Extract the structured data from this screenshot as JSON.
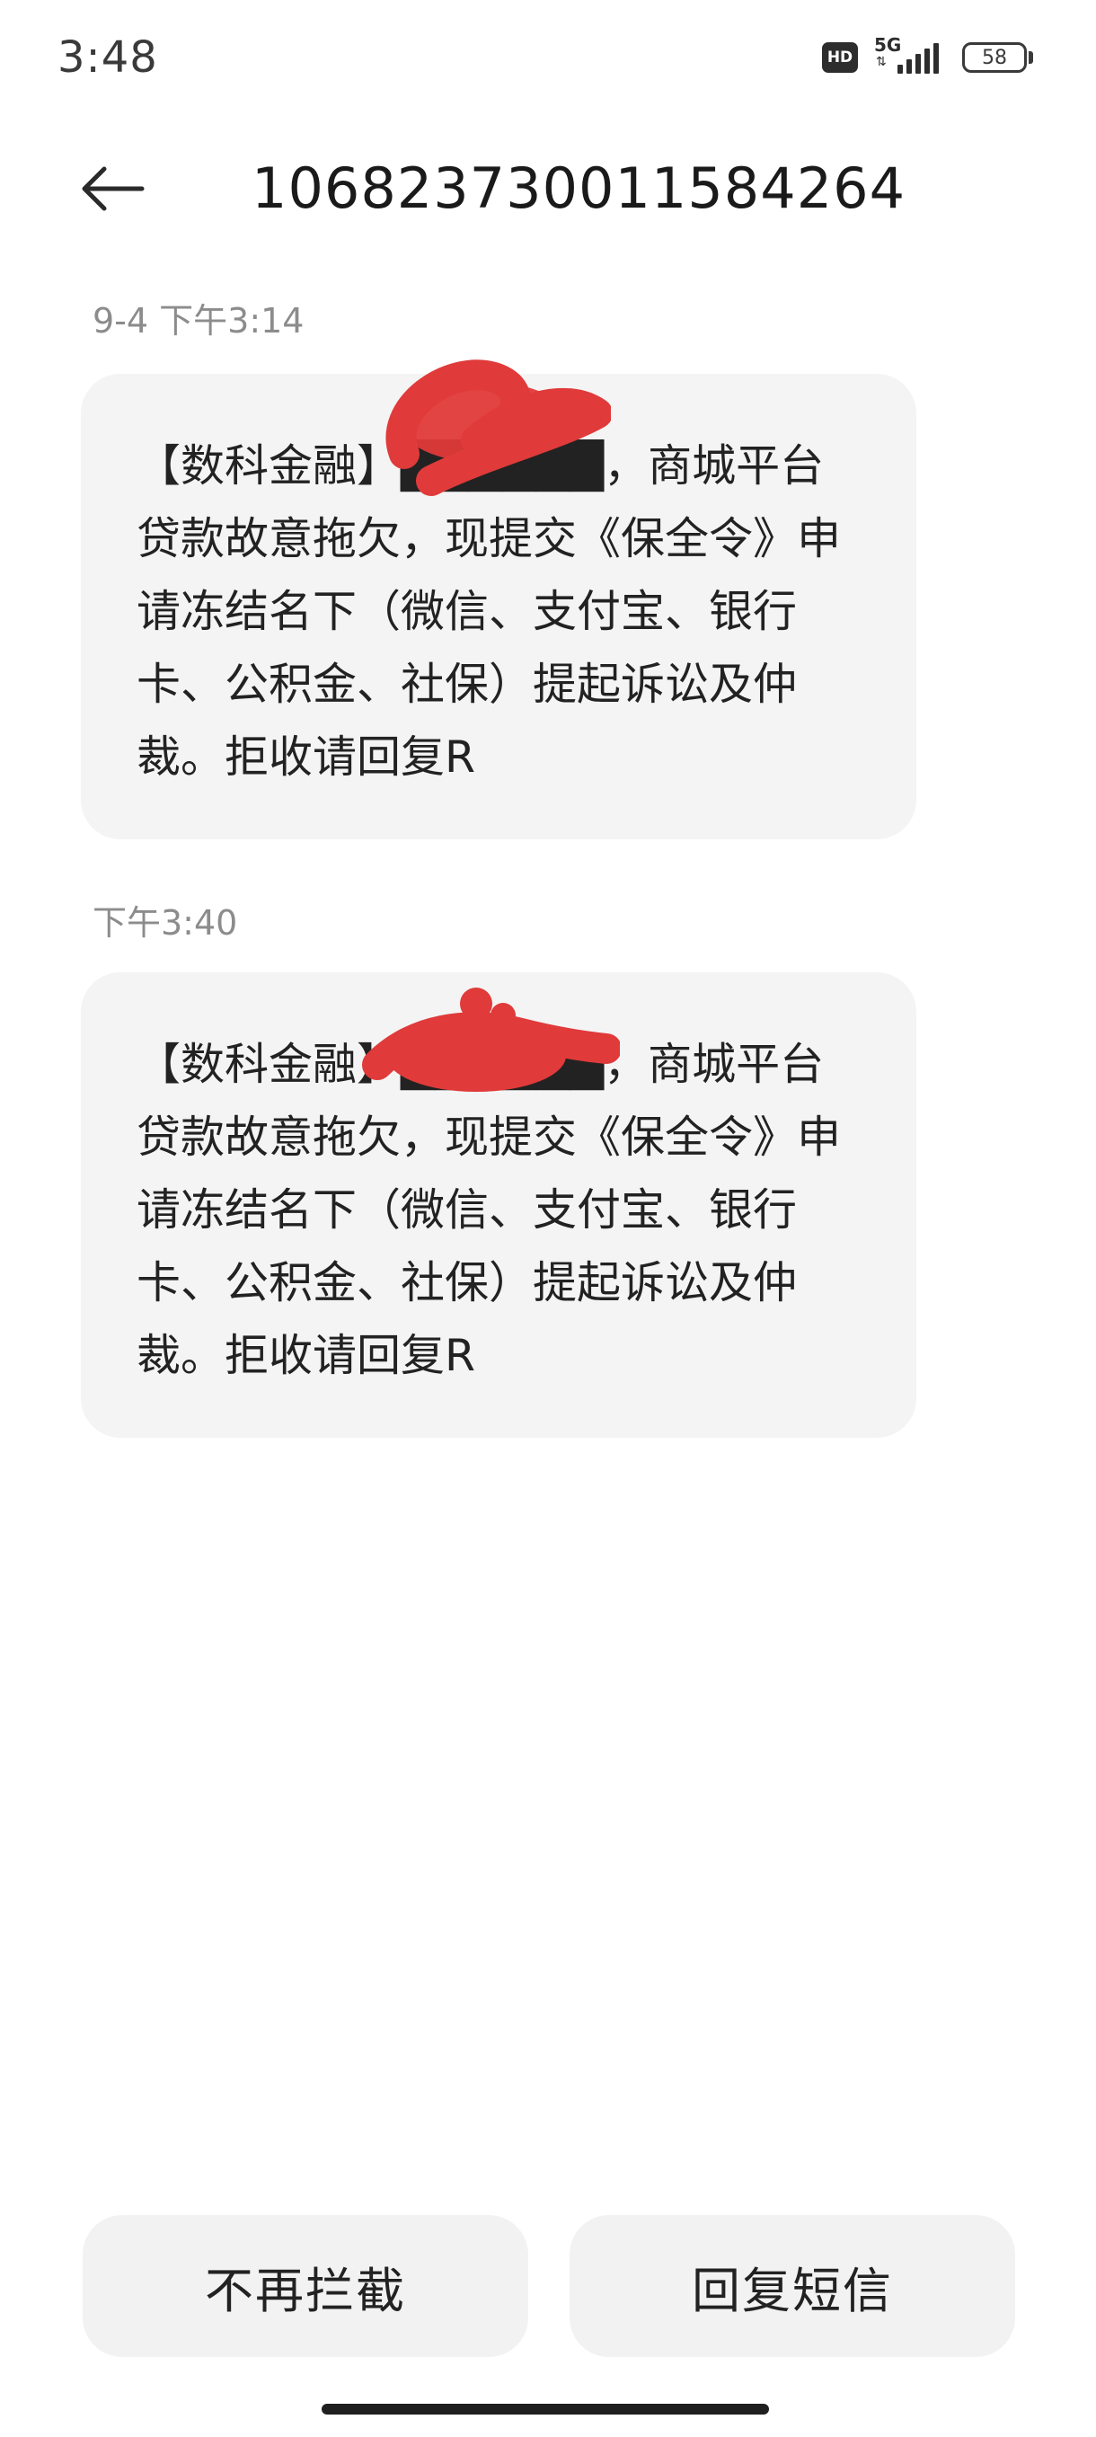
{
  "status_bar": {
    "time": "3:48",
    "hd_badge": "HD",
    "network_type": "5G",
    "network_arrows": "⇅",
    "battery_level": "58",
    "signal_icon": "signal-icon"
  },
  "header": {
    "back_icon": "arrow-left-icon",
    "sender_number": "106823730011584264"
  },
  "messages": [
    {
      "timestamp": "9-4 下午3:14",
      "text": "【数科金融】██████，商城平台贷款故意拖欠，现提交《保全令》申请冻结名下（微信、支付宝、银行卡、公积金、社保）提起诉讼及仲裁。拒收请回复R"
    },
    {
      "timestamp": "下午3:40",
      "text": "【数科金融】██████，商城平台贷款故意拖欠，现提交《保全令》申请冻结名下（微信、支付宝、银行卡、公积金、社保）提起诉讼及仲裁。拒收请回复R"
    }
  ],
  "redaction_color": "#e03a3a",
  "actions": {
    "unblock_label": "不再拦截",
    "reply_label": "回复短信"
  }
}
